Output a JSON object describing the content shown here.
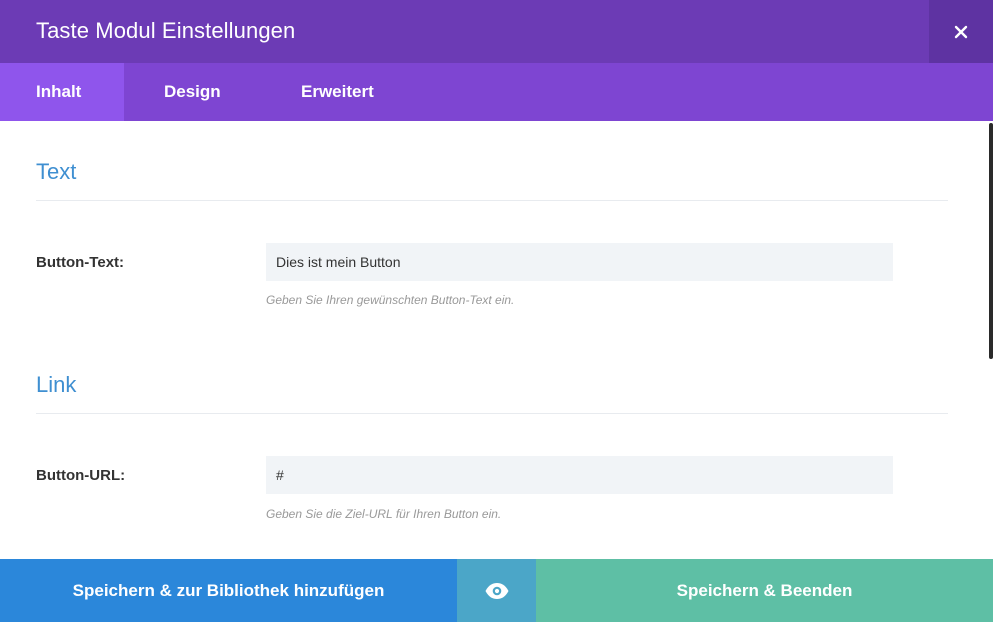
{
  "modal": {
    "title": "Taste Modul Einstellungen",
    "close_icon": "close-icon"
  },
  "tabs": [
    {
      "label": "Inhalt",
      "active": true
    },
    {
      "label": "Design",
      "active": false
    },
    {
      "label": "Erweitert",
      "active": false
    }
  ],
  "sections": {
    "text": {
      "title": "Text",
      "field": {
        "label": "Button-Text:",
        "value": "Dies ist mein Button",
        "hint": "Geben Sie Ihren gewünschten Button-Text ein."
      }
    },
    "link": {
      "title": "Link",
      "field": {
        "label": "Button-URL:",
        "value": "#",
        "hint": "Geben Sie die Ziel-URL für Ihren Button ein."
      }
    }
  },
  "footer": {
    "library_label": "Speichern & zur Bibliothek hinzufügen",
    "preview_icon": "eye-icon",
    "save_label": "Speichern & Beenden"
  },
  "colors": {
    "header": "#6c3bb5",
    "tabs": "#7e45d2",
    "tab_active": "#8f55ec",
    "section_title": "#3f8fd1",
    "library_button": "#2b87da",
    "preview_button": "#4ba6c8",
    "save_button": "#5ebfa5"
  }
}
